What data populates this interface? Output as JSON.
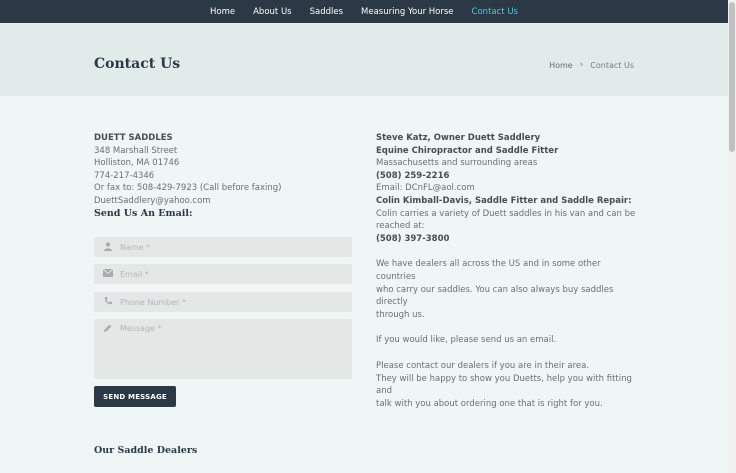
{
  "nav": {
    "items": [
      {
        "label": "Home"
      },
      {
        "label": "About Us"
      },
      {
        "label": "Saddles"
      },
      {
        "label": "Measuring Your Horse"
      },
      {
        "label": "Contact Us",
        "active": true
      }
    ],
    "background": "#2b3846",
    "active_color": "#5fc2d8"
  },
  "header": {
    "title": "Contact Us",
    "breadcrumb": {
      "home": "Home",
      "separator": "›",
      "current": "Contact Us"
    }
  },
  "address": {
    "name": "DUETT SADDLES",
    "street": "348 Marshall Street",
    "city": "Holliston, MA 01746",
    "phone": "774-217-4346",
    "fax": "Or fax to: 508-429-7923 (Call before faxing)",
    "email": "DuettSaddlery@yahoo.com"
  },
  "form": {
    "heading": "Send Us An Email:",
    "name_placeholder": "Name *",
    "email_placeholder": "Email *",
    "phone_placeholder": "Phone Number *",
    "message_placeholder": "Message *",
    "submit_label": "SEND MESSAGE",
    "icons": {
      "name": "user-icon",
      "email": "envelope-icon",
      "phone": "phone-icon",
      "message": "pencil-icon"
    }
  },
  "contacts": {
    "steve_title": "Steve Katz, Owner Duett Saddlery",
    "steve_role": "Equine Chiropractor and Saddle Fitter",
    "steve_area": "Massachusetts and surrounding areas",
    "steve_phone": "(508) 259-2216",
    "steve_email": "Email: DCnFL@aol.com",
    "colin_title": "Colin Kimball-Davis, Saddle Fitter and Saddle Repair:",
    "colin_desc_1": "Colin carries a variety of Duett saddles in his van and can be",
    "colin_desc_2": "reached at:",
    "colin_phone": "(508) 397-3800"
  },
  "info": {
    "para1_line1": "We have dealers all across the US and in some other countries",
    "para1_line2": "who carry our saddles. You can also always buy saddles directly",
    "para1_line3": "through us.",
    "para2": "If you would like, please send us an email.",
    "para3_line1": "Please contact our dealers if you are in their area.",
    "para3_line2": "They will be happy to show you Duetts, help you with fitting and",
    "para3_line3": "talk with you about ordering one that is right for you."
  },
  "dealers": {
    "heading": "Our Saddle Dealers"
  }
}
